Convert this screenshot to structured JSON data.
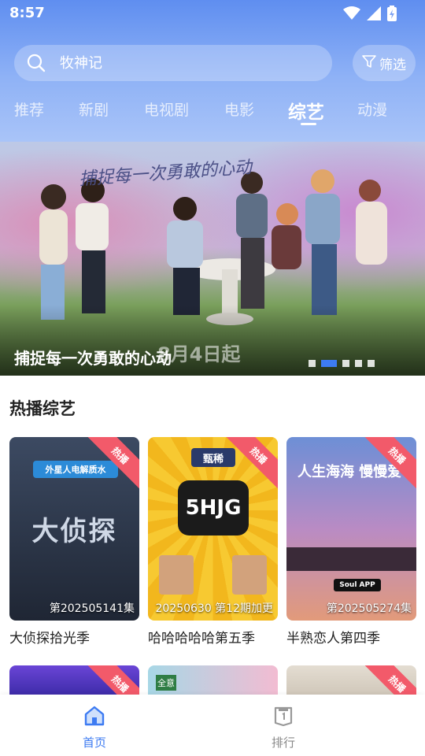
{
  "status_bar": {
    "time": "8:57"
  },
  "search": {
    "placeholder": "牧神记",
    "filter_label": "筛选"
  },
  "tabs": [
    {
      "label": "推荐"
    },
    {
      "label": "新剧"
    },
    {
      "label": "电视剧"
    },
    {
      "label": "电影"
    },
    {
      "label": "综艺",
      "active": true
    },
    {
      "label": "动漫"
    }
  ],
  "banner": {
    "title": "捕捉每一次勇敢的心动",
    "calligraphy": "捕捉每一次勇敢的心动",
    "date_text": "8月4日起",
    "slide_count": 5,
    "active_slide": 2
  },
  "section": {
    "title": "热播综艺"
  },
  "cards": [
    {
      "title": "大侦探拾光季",
      "episode": "第202505141集",
      "badge": "热播",
      "poster_color": "#2b3446",
      "poster_text": "大侦探",
      "sponsor": "外星人电解质水"
    },
    {
      "title": "哈哈哈哈哈第五季",
      "episode": "20250630 第12期加更",
      "badge": "热播",
      "poster_color": "#f4c12a",
      "poster_text": "5HJG",
      "sponsor": "甄稀"
    },
    {
      "title": "半熟恋人第四季",
      "episode": "第202505274集",
      "badge": "热播",
      "poster_color": "#5b7fc0",
      "poster_text": "人生海海 慢慢爱",
      "sponsor": "Soul APP"
    }
  ],
  "row2_cards": [
    {
      "badge": "热播",
      "poster_color": "#5a3fc4"
    },
    {
      "badge": "",
      "poster_color": "#a8d3e4",
      "poster_text": "全意"
    },
    {
      "badge": "热播",
      "poster_color": "#d9d2c6"
    }
  ],
  "bottom_nav": [
    {
      "label": "首页",
      "icon": "home-icon",
      "active": true
    },
    {
      "label": "排行",
      "icon": "ranking-icon",
      "active": false
    }
  ],
  "colors": {
    "accent": "#3d7bf2",
    "badge": "#f25a6a",
    "inactive_nav": "#888888"
  }
}
